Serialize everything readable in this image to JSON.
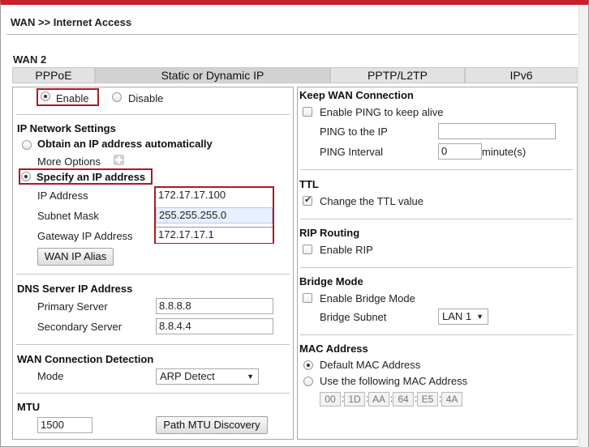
{
  "page": {
    "title": "WAN >> Internet Access",
    "wan_label": "WAN 2"
  },
  "tabs": [
    {
      "label": "PPPoE"
    },
    {
      "label": "Static or Dynamic IP"
    },
    {
      "label": "PPTP/L2TP"
    },
    {
      "label": "IPv6"
    }
  ],
  "enable": {
    "enable_label": "Enable",
    "disable_label": "Disable"
  },
  "ip_settings": {
    "heading": "IP Network Settings",
    "auto_label": "Obtain an IP address automatically",
    "more_options": "More Options",
    "specify_label": "Specify an IP address",
    "ip_label": "IP Address",
    "ip_value": "172.17.17.100",
    "mask_label": "Subnet Mask",
    "mask_value": "255.255.255.0",
    "gw_label": "Gateway IP Address",
    "gw_value": "172.17.17.1",
    "alias_button": "WAN IP Alias"
  },
  "dns": {
    "heading": "DNS Server IP Address",
    "primary_label": "Primary Server",
    "primary_value": "8.8.8.8",
    "secondary_label": "Secondary Server",
    "secondary_value": "8.8.4.4"
  },
  "detection": {
    "heading": "WAN Connection Detection",
    "mode_label": "Mode",
    "mode_value": "ARP Detect"
  },
  "mtu": {
    "heading": "MTU",
    "value": "1500",
    "button": "Path MTU Discovery"
  },
  "keep_wan": {
    "heading": "Keep WAN Connection",
    "ping_label": "Enable PING to keep alive",
    "ping_ip_label": "PING to the IP",
    "ping_ip_value": "",
    "interval_label": "PING Interval",
    "interval_value": "0",
    "interval_unit": "minute(s)"
  },
  "ttl": {
    "heading": "TTL",
    "label": "Change the TTL value"
  },
  "rip": {
    "heading": "RIP Routing",
    "label": "Enable RIP"
  },
  "bridge": {
    "heading": "Bridge Mode",
    "label": "Enable Bridge Mode",
    "subnet_label": "Bridge Subnet",
    "subnet_value": "LAN 1"
  },
  "mac": {
    "heading": "MAC Address",
    "default_label": "Default MAC Address",
    "custom_label": "Use the following MAC Address",
    "octets": [
      "00",
      "1D",
      "AA",
      "64",
      "E5",
      "4A"
    ]
  },
  "colors": {
    "accent_red": "#c8202a",
    "highlight_box": "#a71c22"
  }
}
